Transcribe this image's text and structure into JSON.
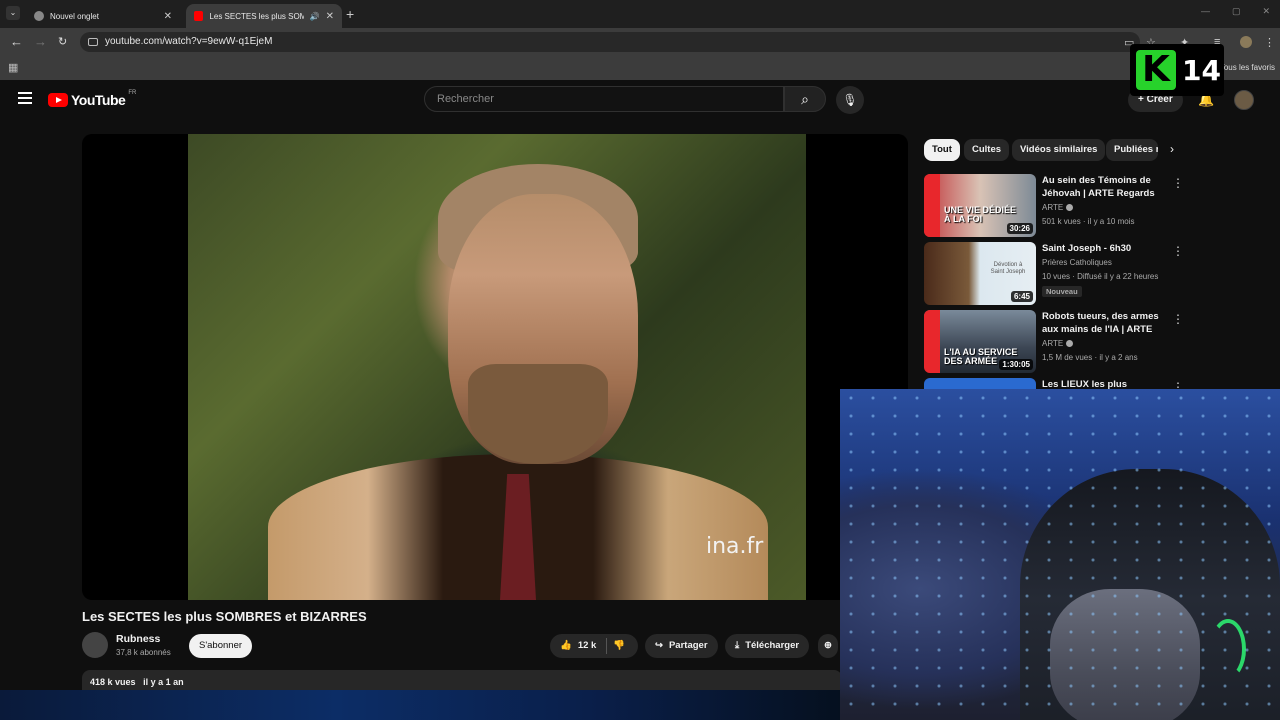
{
  "browser": {
    "tabs": [
      {
        "label": "Nouvel onglet"
      },
      {
        "label": "Les SECTES les plus SOMBÉ"
      }
    ],
    "url": "youtube.com/watch?v=9ewW-q1EjeM",
    "bookmarks_label": "Tous les favoris"
  },
  "youtube": {
    "logo_text": "YouTube",
    "logo_region": "FR",
    "search_placeholder": "Rechercher",
    "create_label": "Créer"
  },
  "video": {
    "watermark": "ina.fr",
    "title": "Les SECTES les plus SOMBRES et BIZARRES",
    "channel": "Rubness",
    "subscribers": "37,8 k abonnés",
    "subscribe_label": "S'abonner",
    "likes": "12 k",
    "share_label": "Partager",
    "download_label": "Télécharger",
    "views": "418 k vues",
    "date": "il y a 1 an"
  },
  "chips": [
    "Tout",
    "Cultes",
    "Vidéos similaires",
    "Publiées r"
  ],
  "recommendations": [
    {
      "title": "Au sein des Témoins de Jéhovah | ARTE Regards",
      "channel": "ARTE",
      "meta": "501 k vues · il y a 10 mois",
      "duration": "30:26",
      "thumb_text": "UNE VIE DÉDIÉE À LA FOI"
    },
    {
      "title": "Saint Joseph - 6h30",
      "channel": "Prières Catholiques",
      "meta": "10 vues · Diffusé il y a 22 heures",
      "duration": "6:45",
      "badge": "Nouveau",
      "thumb_text": "Dévotion à Saint Joseph"
    },
    {
      "title": "Robots tueurs, des armes aux mains de l'IA | ARTE",
      "channel": "ARTE",
      "meta": "1,5 M de vues · il y a 2 ans",
      "duration": "1:30:05",
      "thumb_text": "L'IA AU SERVICE DES ARMÉE"
    },
    {
      "title": "Les LIEUX les plus"
    }
  ],
  "overlay": {
    "k_letter": "K",
    "number": "14"
  },
  "colors": {
    "youtube_red": "#ff0000",
    "k14_green": "#27d22b",
    "arte_red": "#e8272c"
  }
}
